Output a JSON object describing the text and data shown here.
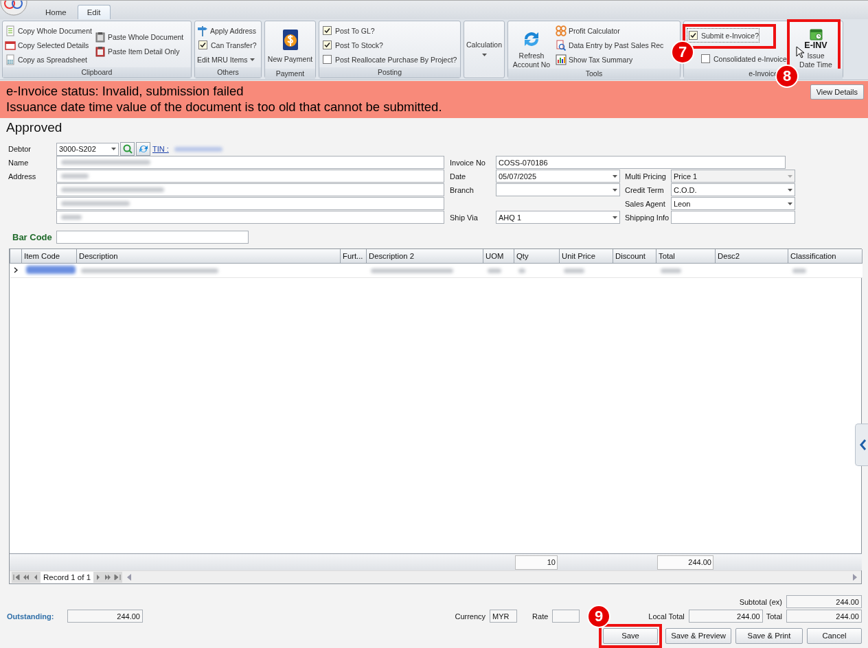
{
  "app_tabs": [
    {
      "label": "Home",
      "selected": false
    },
    {
      "label": "Edit",
      "selected": true
    }
  ],
  "ribbon": [
    {
      "label": "Clipboard",
      "columns": [
        [
          {
            "kind": "small",
            "label": "Copy Whole Document"
          },
          {
            "kind": "small",
            "label": "Copy Selected Details"
          },
          {
            "kind": "small",
            "label": "Copy as Spreadsheet"
          }
        ],
        [
          {
            "kind": "small",
            "label": "Paste Whole Document"
          },
          {
            "kind": "small",
            "label": "Paste Item Detail Only"
          }
        ]
      ]
    },
    {
      "label": "Others",
      "columns": [
        [
          {
            "kind": "small",
            "label": "Apply Address"
          },
          {
            "kind": "check",
            "label": "Can Transfer?",
            "checked": true
          },
          {
            "kind": "menu",
            "label": "Edit MRU Items"
          }
        ]
      ]
    },
    {
      "label": "Payment",
      "columns": [
        [
          {
            "kind": "large",
            "label": "New Payment"
          }
        ]
      ]
    },
    {
      "label": "Posting",
      "columns": [
        [
          {
            "kind": "check",
            "label": "Post To GL?",
            "checked": true
          },
          {
            "kind": "check",
            "label": "Post To Stock?",
            "checked": true
          },
          {
            "kind": "check",
            "label": "Post Reallocate Purchase By Project?",
            "checked": false
          }
        ]
      ]
    },
    {
      "columns": [
        [
          {
            "kind": "large-menu",
            "label": "Calculation"
          }
        ]
      ]
    },
    {
      "label": "Tools",
      "columns": [
        [
          {
            "kind": "large",
            "label": "Refresh\nAccount No"
          }
        ],
        [
          {
            "kind": "small",
            "label": "Profit Calculator"
          },
          {
            "kind": "small",
            "label": "Data Entry by Past Sales Rec"
          },
          {
            "kind": "small",
            "label": "Show Tax Summary"
          }
        ]
      ]
    },
    {
      "label": "e-Invoice",
      "columns": [
        [
          {
            "kind": "check",
            "label": "Submit e-Invoice?",
            "checked": true,
            "focused": true,
            "callout": {
              "number": "7"
            }
          },
          {
            "kind": "check",
            "label": "Consolidated e-Invoice",
            "checked": false
          }
        ],
        [
          {
            "kind": "large",
            "badge": "E-INV",
            "label": "Issue\nDate Time",
            "pointer": true,
            "callout": {
              "number": "8"
            }
          }
        ]
      ]
    }
  ],
  "banner": {
    "status": "e-Invoice status: Invalid, submission failed",
    "message": "Issuance date time value of the document is too old that cannot be submitted.",
    "button": "View Details"
  },
  "document_status": "Approved",
  "debtor": {
    "label": "Debtor",
    "value": "3000-S202",
    "tin_label": "TIN :",
    "tin_redacted": true
  },
  "name": {
    "label": "Name",
    "redacted": true
  },
  "address": {
    "label": "Address",
    "lines": [
      {
        "redacted": true
      },
      {
        "redacted": true
      },
      {
        "redacted": true
      },
      {
        "redacted": true
      }
    ]
  },
  "fields_middle": [
    {
      "kind": "text",
      "label": "Invoice No",
      "value": "COSS-070186",
      "disabled": false
    },
    {
      "kind": "combo",
      "label": "Date",
      "value": "05/07/2025",
      "disabled": false
    },
    {
      "kind": "combo",
      "label": "Branch",
      "disabled": false
    },
    {
      "kind": "combo",
      "label": "Ship Via",
      "value": "AHQ 1",
      "disabled": false
    }
  ],
  "fields_right": [
    {
      "kind": "combo",
      "label": "Multi Pricing",
      "value": "Price 1",
      "disabled": true
    },
    {
      "kind": "combo",
      "label": "Credit Term",
      "value": "C.O.D.",
      "disabled": false
    },
    {
      "kind": "combo",
      "label": "Sales Agent",
      "value": "Leon",
      "disabled": false
    },
    {
      "kind": "text",
      "label": "Shipping Info",
      "disabled": false
    }
  ],
  "bar_code": {
    "label": "Bar Code"
  },
  "table": {
    "columns": [
      "Item Code",
      "Description",
      "Furt...",
      "Description 2",
      "UOM",
      "Qty",
      "Unit Price",
      "Discount",
      "Total",
      "Desc2",
      "Classification"
    ],
    "rows": [
      {
        "current": true,
        "redacted": true
      }
    ],
    "summary": {
      "qty": "10",
      "total": "244.00"
    },
    "navigator": "Record 1 of 1"
  },
  "totals": {
    "subtotal_label": "Subtotal (ex)",
    "subtotal": "244.00",
    "outstanding_label": "Outstanding:",
    "outstanding": "244.00",
    "currency_label": "Currency",
    "currency": "MYR",
    "rate_label": "Rate",
    "local_total_label": "Local Total",
    "local_total": "244.00",
    "total_label": "Total",
    "total": "244.00"
  },
  "buttons": [
    {
      "label": "Save",
      "callout": {
        "number": "9"
      }
    },
    {
      "label": "Save & Preview"
    },
    {
      "label": "Save & Print"
    },
    {
      "label": "Cancel"
    }
  ]
}
